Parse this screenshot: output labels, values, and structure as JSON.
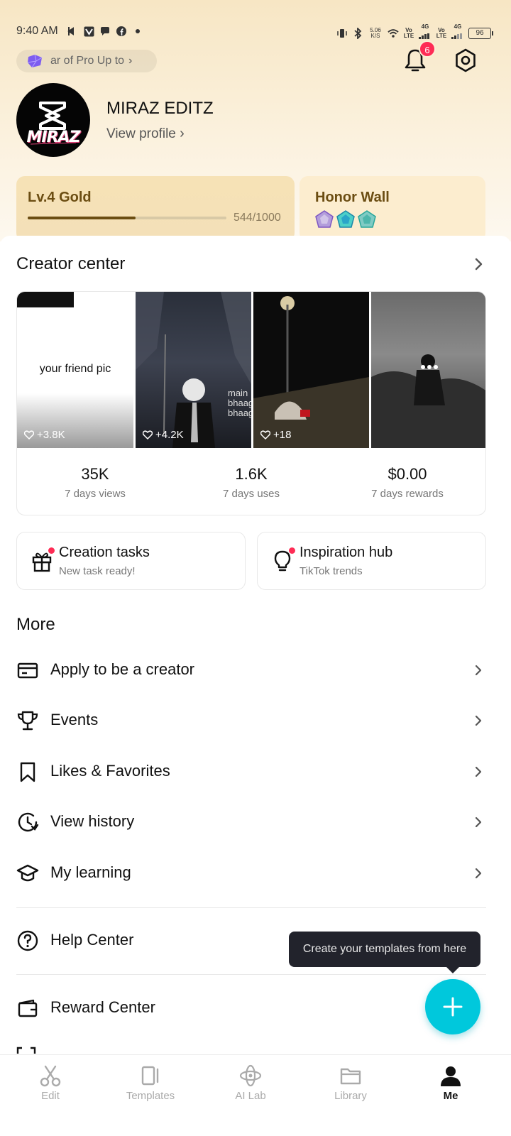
{
  "status_bar": {
    "time": "9:40 AM",
    "net_speed": "5.06",
    "net_unit": "K/S",
    "battery": "96",
    "signal1": "Vo LTE",
    "signal2": "4G"
  },
  "header": {
    "pro_banner": "ar of Pro  Up to",
    "notification_count": "6",
    "colors": {
      "accent_badge": "#fe2c55",
      "fab": "#00c8dc",
      "gold": "#6b4d12"
    }
  },
  "profile": {
    "name": "MIRAZ EDITZ",
    "view_profile": "View profile",
    "avatar_text": "MIRAZ"
  },
  "level": {
    "title": "Lv.4 Gold",
    "progress_text": "544/1000",
    "progress_fraction": 0.544
  },
  "honor": {
    "title": "Honor Wall"
  },
  "creator_center": {
    "title": "Creator center",
    "thumbnails": [
      {
        "caption": "your friend pic",
        "likes": "+3.8K"
      },
      {
        "caption": "main bhaag bhaag",
        "likes": "+4.2K"
      },
      {
        "caption": "",
        "likes": "+18"
      },
      {
        "caption": "",
        "likes": ""
      }
    ],
    "stats": [
      {
        "value": "35K",
        "label": "7 days views"
      },
      {
        "value": "1.6K",
        "label": "7 days uses"
      },
      {
        "value": "$0.00",
        "label": "7 days rewards"
      }
    ]
  },
  "tasks": [
    {
      "title": "Creation tasks",
      "subtitle": "New task ready!"
    },
    {
      "title": "Inspiration hub",
      "subtitle": "TikTok trends"
    }
  ],
  "more": {
    "title": "More",
    "items": [
      {
        "label": "Apply to be a creator",
        "icon": "card-icon"
      },
      {
        "label": "Events",
        "icon": "trophy-icon"
      },
      {
        "label": "Likes & Favorites",
        "icon": "bookmark-icon"
      },
      {
        "label": "View history",
        "icon": "history-icon"
      },
      {
        "label": "My learning",
        "icon": "graduation-cap-icon"
      },
      {
        "label": "Help Center",
        "icon": "help-icon"
      },
      {
        "label": "Reward Center",
        "icon": "wallet-icon"
      }
    ]
  },
  "tooltip": {
    "text": "Create your templates from here"
  },
  "bottom_nav": [
    {
      "label": "Edit",
      "icon": "scissors-icon"
    },
    {
      "label": "Templates",
      "icon": "templates-icon"
    },
    {
      "label": "AI Lab",
      "icon": "ai-lab-icon"
    },
    {
      "label": "Library",
      "icon": "folder-icon"
    },
    {
      "label": "Me",
      "icon": "person-icon",
      "active": true
    }
  ]
}
